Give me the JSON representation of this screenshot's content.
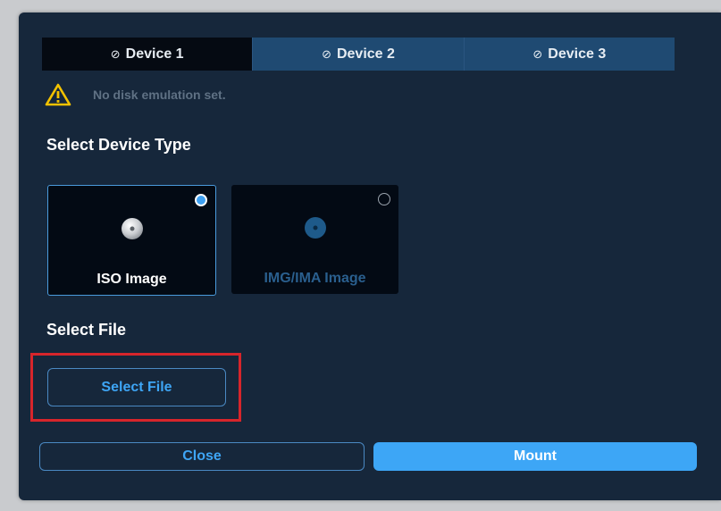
{
  "tabs": [
    {
      "label": "Device 1",
      "icon": "no-symbol-icon",
      "active": true
    },
    {
      "label": "Device 2",
      "icon": "no-symbol-icon",
      "active": false
    },
    {
      "label": "Device 3",
      "icon": "no-symbol-icon",
      "active": false
    }
  ],
  "warning": {
    "icon": "warning-icon",
    "text": "No disk emulation set."
  },
  "device_type": {
    "title": "Select Device Type",
    "options": [
      {
        "label": "ISO Image",
        "selected": true,
        "icon": "disc-icon"
      },
      {
        "label": "IMG/IMA Image",
        "selected": false,
        "icon": "disc-icon"
      }
    ]
  },
  "file": {
    "title": "Select File",
    "button_label": "Select File"
  },
  "footer": {
    "close_label": "Close",
    "mount_label": "Mount"
  },
  "colors": {
    "accent": "#3da6f6",
    "background": "#16273b",
    "highlight": "#d7252b"
  }
}
